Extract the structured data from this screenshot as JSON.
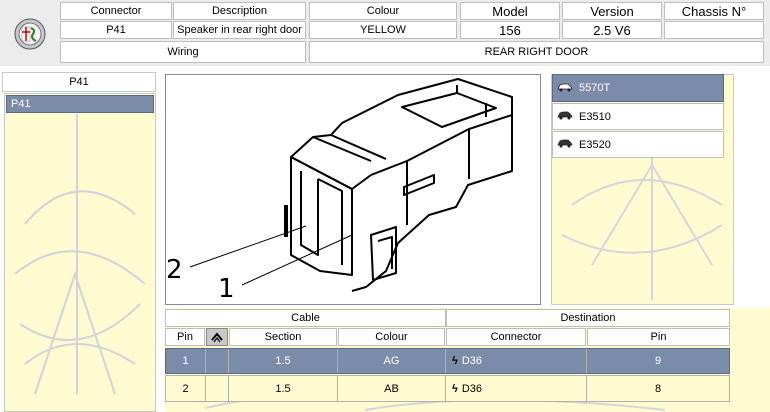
{
  "header": {
    "connector_label": "Connector",
    "connector_value": "P41",
    "description_label": "Description",
    "description_value": "Speaker in rear right door",
    "colour_label": "Colour",
    "colour_value": "YELLOW",
    "model_label": "Model",
    "model_value": "156",
    "version_label": "Version",
    "version_value": "2.5 V6",
    "chassis_label": "Chassis N°",
    "chassis_value": "",
    "wiring_label": "Wiring",
    "wiring_value": "REAR RIGHT DOOR"
  },
  "left_panel": {
    "title": "P41",
    "items": [
      {
        "label": "P41",
        "selected": true
      }
    ]
  },
  "diagram": {
    "callouts": [
      "2",
      "1"
    ]
  },
  "right_panel": {
    "items": [
      {
        "label": "5570T",
        "selected": true
      },
      {
        "label": "E3510",
        "selected": false
      },
      {
        "label": "E3520",
        "selected": false
      }
    ]
  },
  "pin_table": {
    "group_cable": "Cable",
    "group_destination": "Destination",
    "headers": {
      "pin": "Pin",
      "section": "Section",
      "colour": "Colour",
      "connector": "Connector",
      "dest_pin": "Pin"
    },
    "rows": [
      {
        "pin": "1",
        "section": "1.5",
        "colour": "AG",
        "connector": "D36",
        "dest_pin": "9",
        "selected": true
      },
      {
        "pin": "2",
        "section": "1.5",
        "colour": "AB",
        "connector": "D36",
        "dest_pin": "8",
        "selected": false
      }
    ]
  },
  "colors": {
    "selected": "#7b8ca8",
    "panel_bg": "#fffbd0"
  }
}
